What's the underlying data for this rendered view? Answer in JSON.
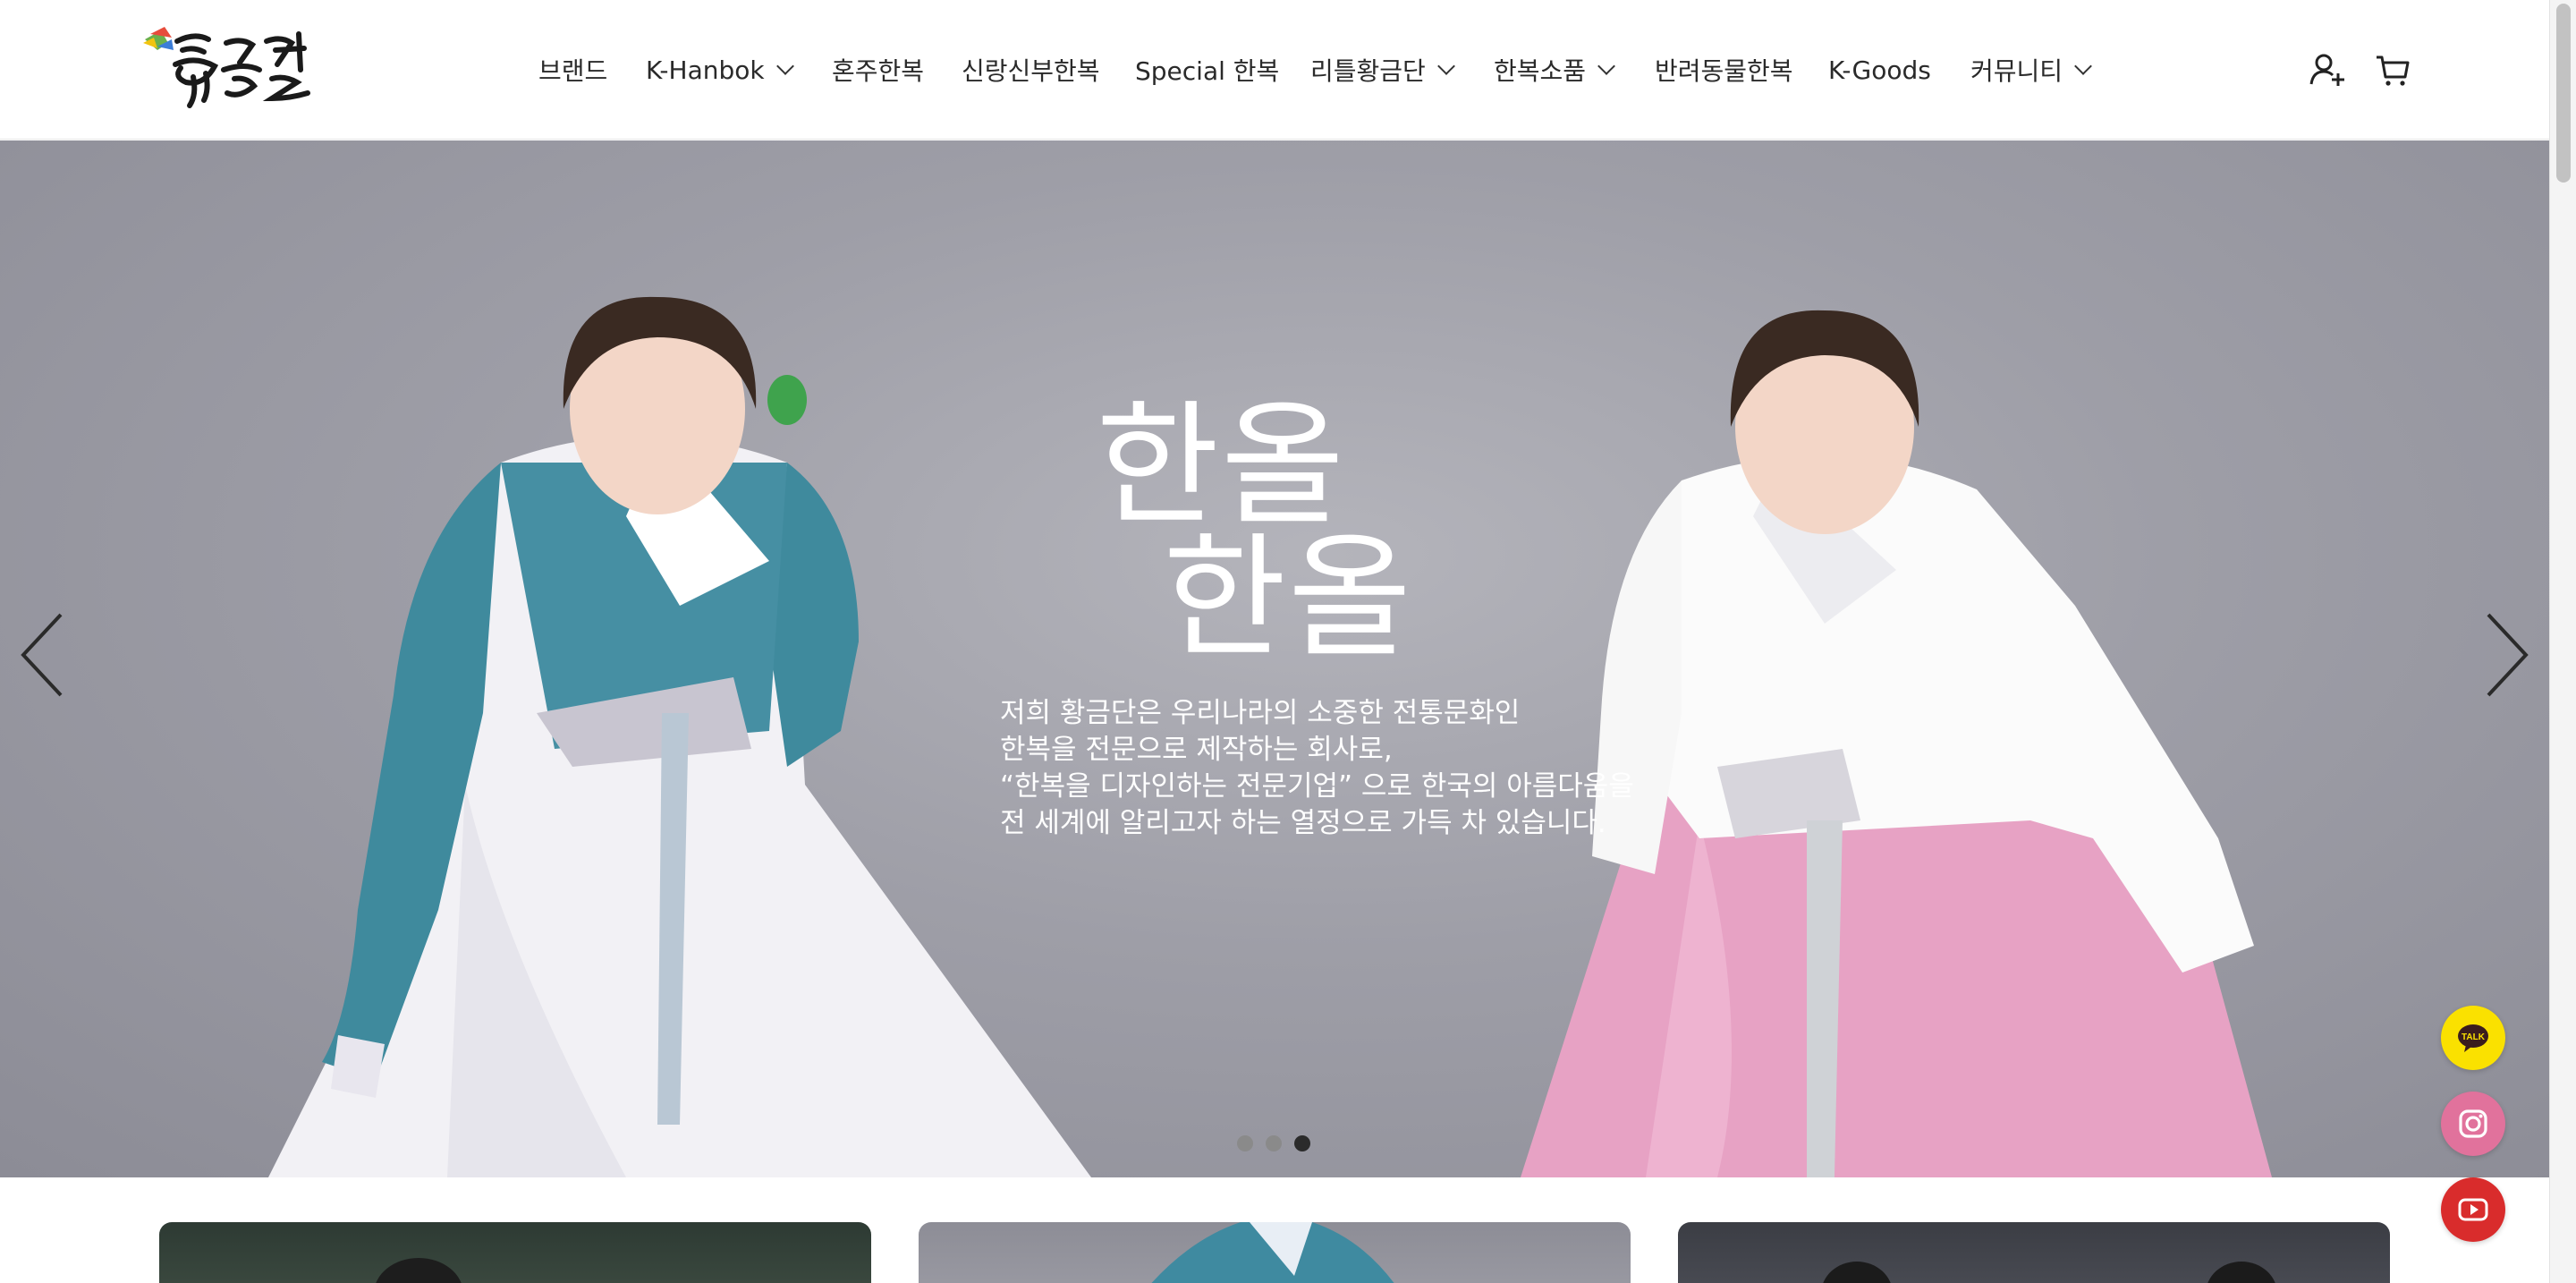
{
  "header": {
    "logo_alt": "황금단",
    "nav": [
      {
        "label": "브랜드",
        "dropdown": false
      },
      {
        "label": "K-Hanbok",
        "dropdown": true
      },
      {
        "label": "혼주한복",
        "dropdown": false
      },
      {
        "label": "신랑신부한복",
        "dropdown": false
      },
      {
        "label": "Special 한복",
        "dropdown": false
      },
      {
        "label": "리틀황금단",
        "dropdown": true
      },
      {
        "label": "한복소품",
        "dropdown": true
      },
      {
        "label": "반려동물한복",
        "dropdown": false
      },
      {
        "label": "K-Goods",
        "dropdown": false
      },
      {
        "label": "커뮤니티",
        "dropdown": true
      }
    ],
    "icons": [
      "user-add-icon",
      "cart-icon"
    ]
  },
  "hero": {
    "title_line1": "한올",
    "title_line2": "한올",
    "description": [
      "저희 황금단은 우리나라의 소중한 전통문화인",
      "한복을 전문으로 제작하는 회사로,",
      "“한복을 디자인하는 전문기업” 으로 한국의 아름다움을",
      "전 세계에 알리고자 하는 열정으로 가득 차 있습니다."
    ],
    "slide_count": 3,
    "active_slide": 3
  },
  "floating": {
    "talk_label": "TALK",
    "talk_color": "#fae100",
    "instagram_color": "#e1729c",
    "youtube_color": "#d92c2c"
  },
  "colors": {
    "hero_bg": "#9e9ea7",
    "text_white": "#ffffff"
  }
}
